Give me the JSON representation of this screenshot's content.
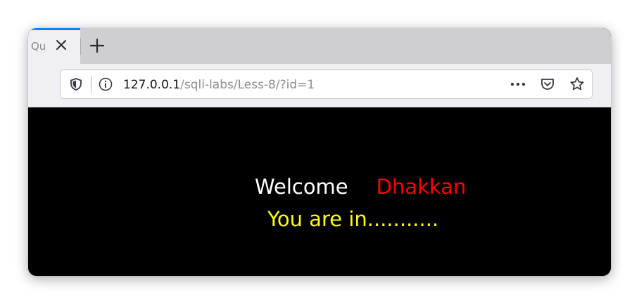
{
  "browser": {
    "tab": {
      "title": "Qu",
      "close_icon": "close-icon",
      "accent_color": "#0a84ff"
    },
    "new_tab_icon": "plus-icon",
    "url_bar": {
      "tracking_icon": "shield-icon",
      "info_icon": "info-icon",
      "url_host": "127.0.0.1",
      "url_path": "/sqli-labs/Less-8/?id=1",
      "page_actions_icon": "more-dots-icon",
      "pocket_icon": "pocket-icon",
      "bookmark_icon": "star-icon"
    }
  },
  "page": {
    "background": "#000000",
    "welcome": "Welcome",
    "welcome_color": "#ffffff",
    "name": "Dhakkan",
    "name_color": "#ff0000",
    "status": "You are in...........",
    "status_color": "#ffff00"
  }
}
